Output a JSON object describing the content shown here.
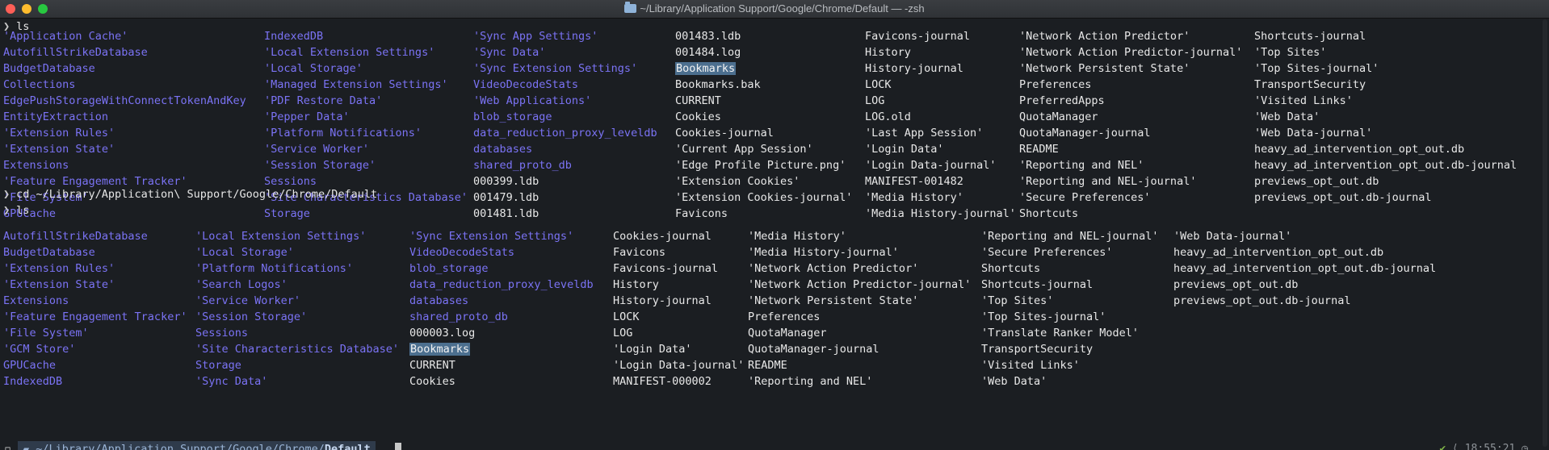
{
  "window": {
    "title": "~/Library/Application Support/Google/Chrome/Default — -zsh"
  },
  "colors": {
    "dir": "#7b73f5",
    "file": "#e8e8e8",
    "highlight": "#4c6f8f",
    "bg": "#1b1e22"
  },
  "prompt": {
    "symbol": "❯"
  },
  "commands": [
    "ls",
    "cd ~/Library/Application\\ Support/Google/Chrome/Default",
    "ls"
  ],
  "listing1": {
    "columns": [
      [
        "'Application Cache'",
        "AutofillStrikeDatabase",
        "BudgetDatabase",
        "Collections",
        "EdgePushStorageWithConnectTokenAndKey",
        "EntityExtraction",
        "'Extension Rules'",
        "'Extension State'",
        "Extensions",
        "'Feature Engagement Tracker'",
        "'File System'",
        "GPUCache"
      ],
      [
        "IndexedDB",
        "'Local Extension Settings'",
        "'Local Storage'",
        "'Managed Extension Settings'",
        "'PDF Restore Data'",
        "'Pepper Data'",
        "'Platform Notifications'",
        "'Service Worker'",
        "'Session Storage'",
        "Sessions",
        "'Site Characteristics Database'",
        "Storage"
      ],
      [
        "'Sync App Settings'",
        "'Sync Data'",
        "'Sync Extension Settings'",
        "VideoDecodeStats",
        "'Web Applications'",
        "blob_storage",
        "data_reduction_proxy_leveldb",
        "databases",
        "shared_proto_db",
        "000399.ldb",
        "001479.ldb",
        "001481.ldb"
      ],
      [
        "001483.ldb",
        "001484.log",
        "Bookmarks",
        "Bookmarks.bak",
        "CURRENT",
        "Cookies",
        "Cookies-journal",
        "'Current App Session'",
        "'Edge Profile Picture.png'",
        "'Extension Cookies'",
        "'Extension Cookies-journal'",
        "Favicons"
      ],
      [
        "Favicons-journal",
        "History",
        "History-journal",
        "LOCK",
        "LOG",
        "LOG.old",
        "'Last App Session'",
        "'Login Data'",
        "'Login Data-journal'",
        "MANIFEST-001482",
        "'Media History'",
        "'Media History-journal'"
      ],
      [
        "'Network Action Predictor'",
        "'Network Action Predictor-journal'",
        "'Network Persistent State'",
        "Preferences",
        "PreferredApps",
        "QuotaManager",
        "QuotaManager-journal",
        "README",
        "'Reporting and NEL'",
        "'Reporting and NEL-journal'",
        "'Secure Preferences'",
        "Shortcuts"
      ],
      [
        "Shortcuts-journal",
        "'Top Sites'",
        "'Top Sites-journal'",
        "TransportSecurity",
        "'Visited Links'",
        "'Web Data'",
        "'Web Data-journal'",
        "heavy_ad_intervention_opt_out.db",
        "heavy_ad_intervention_opt_out.db-journal",
        "previews_opt_out.db",
        "previews_opt_out.db-journal"
      ]
    ],
    "dir_counts": [
      12,
      12,
      9,
      0,
      0,
      0,
      0
    ]
  },
  "listing2": {
    "columns": [
      [
        "AutofillStrikeDatabase",
        "BudgetDatabase",
        "'Extension Rules'",
        "'Extension State'",
        "Extensions",
        "'Feature Engagement Tracker'",
        "'File System'",
        "'GCM Store'",
        "GPUCache",
        "IndexedDB"
      ],
      [
        "'Local Extension Settings'",
        "'Local Storage'",
        "'Platform Notifications'",
        "'Search Logos'",
        "'Service Worker'",
        "'Session Storage'",
        "Sessions",
        "'Site Characteristics Database'",
        "Storage",
        "'Sync Data'"
      ],
      [
        "'Sync Extension Settings'",
        "VideoDecodeStats",
        "blob_storage",
        "data_reduction_proxy_leveldb",
        "databases",
        "shared_proto_db",
        "000003.log",
        "Bookmarks",
        "CURRENT",
        "Cookies"
      ],
      [
        "Cookies-journal",
        "Favicons",
        "Favicons-journal",
        "History",
        "History-journal",
        "LOCK",
        "LOG",
        "'Login Data'",
        "'Login Data-journal'",
        "MANIFEST-000002"
      ],
      [
        "'Media History'",
        "'Media History-journal'",
        "'Network Action Predictor'",
        "'Network Action Predictor-journal'",
        "'Network Persistent State'",
        "Preferences",
        "QuotaManager",
        "QuotaManager-journal",
        "README",
        "'Reporting and NEL'"
      ],
      [
        "'Reporting and NEL-journal'",
        "'Secure Preferences'",
        "Shortcuts",
        "Shortcuts-journal",
        "'Top Sites'",
        "'Top Sites-journal'",
        "'Translate Ranker Model'",
        "TransportSecurity",
        "'Visited Links'",
        "'Web Data'"
      ],
      [
        "'Web Data-journal'",
        "heavy_ad_intervention_opt_out.db",
        "heavy_ad_intervention_opt_out.db-journal",
        "previews_opt_out.db",
        "previews_opt_out.db-journal"
      ]
    ],
    "dir_counts": [
      10,
      10,
      6,
      0,
      0,
      0,
      0
    ]
  },
  "statusbar": {
    "path_prefix": "~/Library/Application Support/Google/Chrome/",
    "path_current": "Default",
    "time": "18:55:21",
    "check": "✔",
    "apple_icon": "apple-icon",
    "clock_icon": "clock-icon"
  }
}
